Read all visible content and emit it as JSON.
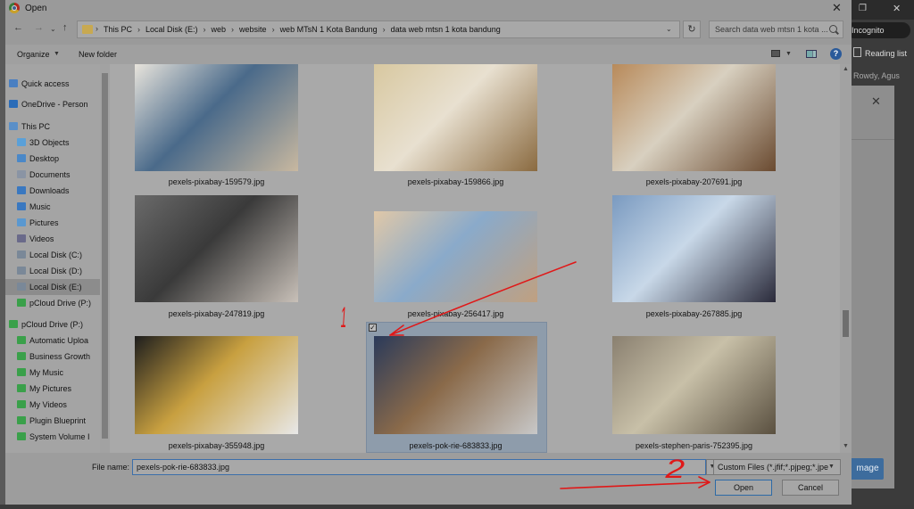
{
  "dialog": {
    "title": "Open",
    "close_glyph": "✕"
  },
  "nav": {
    "back": "←",
    "forward": "→",
    "recent": "⌄",
    "up": "↑",
    "refresh": "↻"
  },
  "address": {
    "breadcrumb": [
      "This PC",
      "Local Disk (E:)",
      "web",
      "website",
      "web MTsN 1 Kota Bandung",
      "data web mtsn 1 kota bandung"
    ],
    "separator": "›"
  },
  "search": {
    "placeholder": "Search data web mtsn 1 kota ..."
  },
  "toolbar": {
    "organize": "Organize",
    "new_folder": "New folder",
    "help": "?"
  },
  "sidebar": {
    "items": [
      {
        "label": "Quick access",
        "icon": "star-icon",
        "color": "#4a7fc1"
      },
      {
        "label": "OneDrive - Person",
        "icon": "cloud-icon",
        "color": "#2a6cb8"
      },
      {
        "label": "This PC",
        "icon": "monitor-icon",
        "color": "#5a8fc8"
      },
      {
        "label": "3D Objects",
        "icon": "cube-icon",
        "color": "#5aa0d8"
      },
      {
        "label": "Desktop",
        "icon": "desktop-icon",
        "color": "#4a88c8"
      },
      {
        "label": "Documents",
        "icon": "document-icon",
        "color": "#8a94a4"
      },
      {
        "label": "Downloads",
        "icon": "download-icon",
        "color": "#3a78c0"
      },
      {
        "label": "Music",
        "icon": "music-icon",
        "color": "#3a78c0"
      },
      {
        "label": "Pictures",
        "icon": "pictures-icon",
        "color": "#5a98d0"
      },
      {
        "label": "Videos",
        "icon": "video-icon",
        "color": "#6a6a8a"
      },
      {
        "label": "Local Disk (C:)",
        "icon": "drive-icon",
        "color": "#7a8898"
      },
      {
        "label": "Local Disk (D:)",
        "icon": "drive-icon",
        "color": "#7a8898"
      },
      {
        "label": "Local Disk (E:)",
        "icon": "drive-icon",
        "color": "#7a8898"
      },
      {
        "label": "pCloud Drive (P:)",
        "icon": "pcloud-icon",
        "color": "#3aa04a"
      },
      {
        "label": "pCloud Drive (P:)",
        "icon": "pcloud-icon",
        "color": "#3aa04a"
      },
      {
        "label": "Automatic Uploa",
        "icon": "folder-icon",
        "color": "#3aa04a"
      },
      {
        "label": "Business Growth",
        "icon": "folder-icon",
        "color": "#3aa04a"
      },
      {
        "label": "My Music",
        "icon": "folder-icon",
        "color": "#3aa04a"
      },
      {
        "label": "My Pictures",
        "icon": "folder-icon",
        "color": "#3aa04a"
      },
      {
        "label": "My Videos",
        "icon": "folder-icon",
        "color": "#3aa04a"
      },
      {
        "label": "Plugin Blueprint",
        "icon": "folder-icon",
        "color": "#3aa04a"
      },
      {
        "label": "System Volume I",
        "icon": "folder-icon",
        "color": "#3aa04a"
      }
    ]
  },
  "files": [
    {
      "name": "pexels-pixabay-159579.jpg",
      "icon": "image-crayons-icon",
      "colors": [
        "#e8e4dc",
        "#c8b8a0",
        "#4a6a8a"
      ]
    },
    {
      "name": "pexels-pixabay-159866.jpg",
      "icon": "image-open-book-icon",
      "colors": [
        "#d8c8a0",
        "#8a6a40",
        "#e8e0d0"
      ]
    },
    {
      "name": "pexels-pixabay-207691.jpg",
      "icon": "image-lecture-hall-icon",
      "colors": [
        "#b88a5a",
        "#6a4a30",
        "#d8d0c0"
      ]
    },
    {
      "name": "pexels-pixabay-247819.jpg",
      "icon": "image-learn-tiles-icon",
      "colors": [
        "#6a6a6a",
        "#c8c0b8",
        "#3a3a3a"
      ]
    },
    {
      "name": "pexels-pixabay-256417.jpg",
      "icon": "image-scrabble-icon",
      "colors": [
        "#e0c8a8",
        "#c0a080",
        "#8aaaca"
      ]
    },
    {
      "name": "pexels-pixabay-267885.jpg",
      "icon": "image-graduation-icon",
      "colors": [
        "#7a9ac0",
        "#2a2a3a",
        "#c8d8e8"
      ]
    },
    {
      "name": "pexels-pixabay-355948.jpg",
      "icon": "image-lightbulb-icon",
      "colors": [
        "#1e1e1e",
        "#e8e8e8",
        "#c8a040"
      ]
    },
    {
      "name": "pexels-pok-rie-683833.jpg",
      "icon": "image-students-icon",
      "colors": [
        "#2a3a5a",
        "#c8c8c8",
        "#8a6a4a"
      ]
    },
    {
      "name": "pexels-stephen-paris-752395.jpg",
      "icon": "image-classroom-icon",
      "colors": [
        "#8a8070",
        "#5a5040",
        "#c8c0a8"
      ]
    }
  ],
  "selected_index": 7,
  "checkbox_glyph": "✓",
  "file_name": {
    "label": "File name:",
    "value": "pexels-pok-rie-683833.jpg"
  },
  "file_type": {
    "value": "Custom Files (*.jfif;*.pjpeg;*.jpe"
  },
  "buttons": {
    "open": "Open",
    "cancel": "Cancel"
  },
  "background_browser": {
    "incognito": "Incognito",
    "reading_list": "Reading list",
    "user": "Rowdy, Agus",
    "image_button": "mage",
    "close_glyph": "✕"
  },
  "annotations": {
    "step1": "1",
    "step2": "2",
    "color": "#e01818"
  }
}
